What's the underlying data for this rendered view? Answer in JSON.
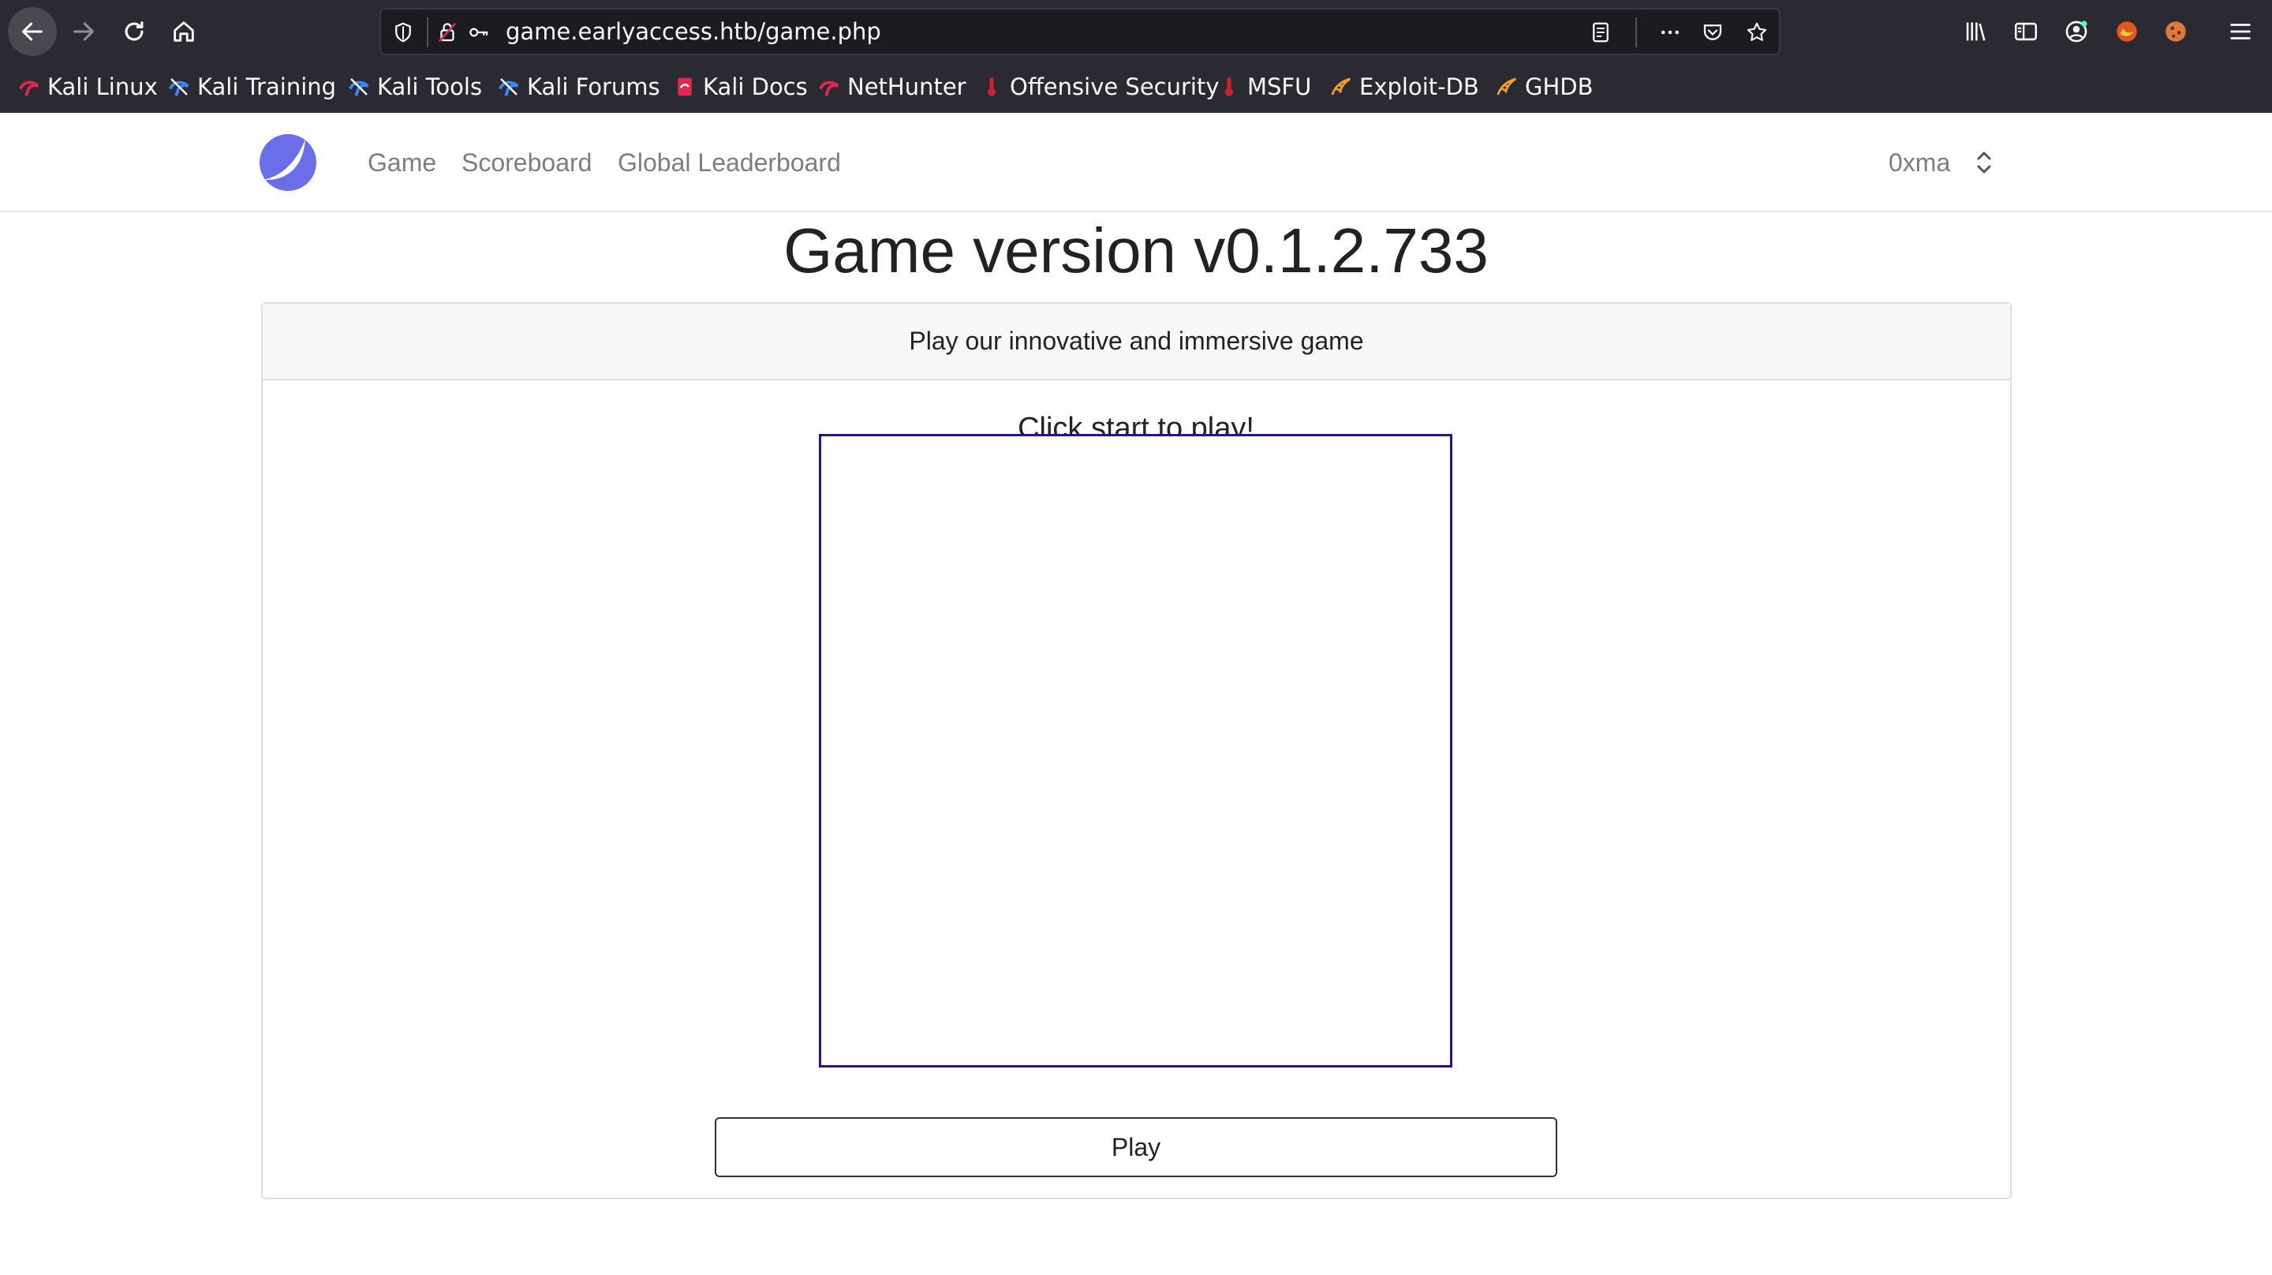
{
  "browser": {
    "url": "game.earlyaccess.htb/game.php",
    "bookmarks": [
      {
        "label": "Kali Linux",
        "icon": "kali-dragon-icon"
      },
      {
        "label": "Kali Training",
        "icon": "kali-training-icon"
      },
      {
        "label": "Kali Tools",
        "icon": "kali-tools-icon"
      },
      {
        "label": "Kali Forums",
        "icon": "kali-forums-icon"
      },
      {
        "label": "Kali Docs",
        "icon": "kali-docs-icon"
      },
      {
        "label": "NetHunter",
        "icon": "nethunter-icon"
      },
      {
        "label": "Offensive Security",
        "icon": "offsec-icon"
      },
      {
        "label": "MSFU",
        "icon": "msfu-icon"
      },
      {
        "label": "Exploit-DB",
        "icon": "exploitdb-icon"
      },
      {
        "label": "GHDB",
        "icon": "ghdb-icon"
      }
    ]
  },
  "site": {
    "nav": {
      "links": [
        "Game",
        "Scoreboard",
        "Global Leaderboard"
      ],
      "user": "0xma"
    },
    "title": "Game version v0.1.2.733",
    "card": {
      "header": "Play our innovative and immersive game",
      "caption": "Click start to play!",
      "play_label": "Play"
    }
  },
  "colors": {
    "chrome_bg": "#2b2a33",
    "urlbar_bg": "#1c1b22",
    "logo": "#6a6ee8",
    "canvas_border": "#1a1a8c",
    "nav_link": "#7d7d7d"
  }
}
